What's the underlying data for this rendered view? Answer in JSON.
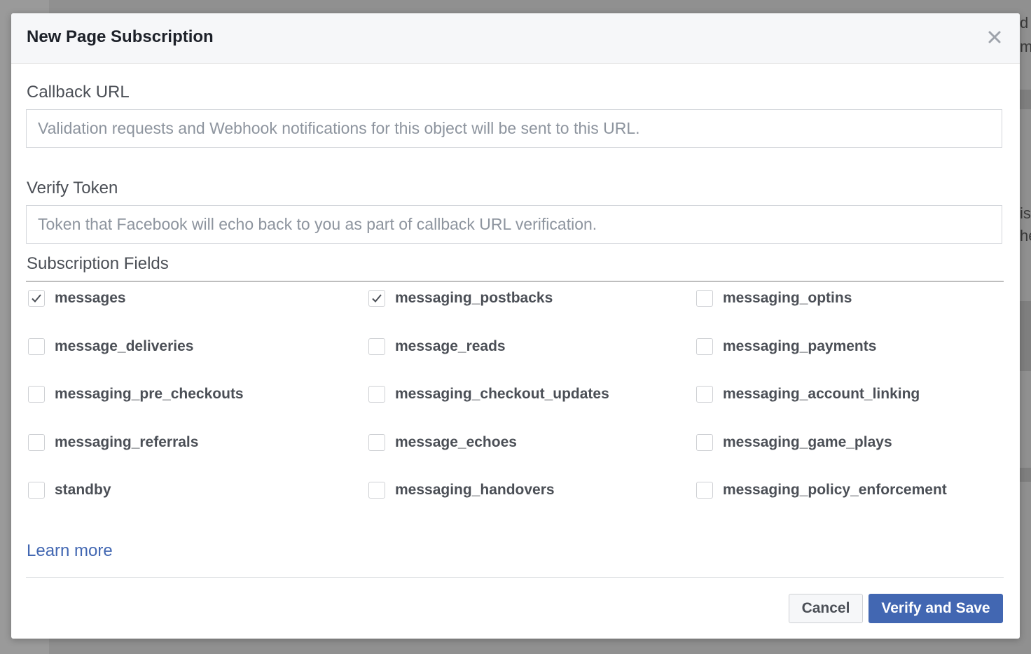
{
  "background": {
    "fragments": [
      "d",
      "m",
      "is",
      "he"
    ]
  },
  "modal": {
    "title": "New Page Subscription",
    "close_icon": "close-icon",
    "callback_url": {
      "label": "Callback URL",
      "value": "",
      "placeholder": "Validation requests and Webhook notifications for this object will be sent to this URL."
    },
    "verify_token": {
      "label": "Verify Token",
      "value": "",
      "placeholder": "Token that Facebook will echo back to you as part of callback URL verification."
    },
    "subscription_fields": {
      "label": "Subscription Fields",
      "items": [
        {
          "label": "messages",
          "checked": true
        },
        {
          "label": "messaging_postbacks",
          "checked": true
        },
        {
          "label": "messaging_optins",
          "checked": false
        },
        {
          "label": "message_deliveries",
          "checked": false
        },
        {
          "label": "message_reads",
          "checked": false
        },
        {
          "label": "messaging_payments",
          "checked": false
        },
        {
          "label": "messaging_pre_checkouts",
          "checked": false
        },
        {
          "label": "messaging_checkout_updates",
          "checked": false
        },
        {
          "label": "messaging_account_linking",
          "checked": false
        },
        {
          "label": "messaging_referrals",
          "checked": false
        },
        {
          "label": "message_echoes",
          "checked": false
        },
        {
          "label": "messaging_game_plays",
          "checked": false
        },
        {
          "label": "standby",
          "checked": false
        },
        {
          "label": "messaging_handovers",
          "checked": false
        },
        {
          "label": "messaging_policy_enforcement",
          "checked": false
        }
      ]
    },
    "learn_more": "Learn more",
    "cancel_label": "Cancel",
    "verify_save_label": "Verify and Save"
  },
  "colors": {
    "primary": "#4267b2",
    "link": "#4267b2",
    "header_bg": "#f6f7f9",
    "overlay": "#8d8d8d"
  }
}
